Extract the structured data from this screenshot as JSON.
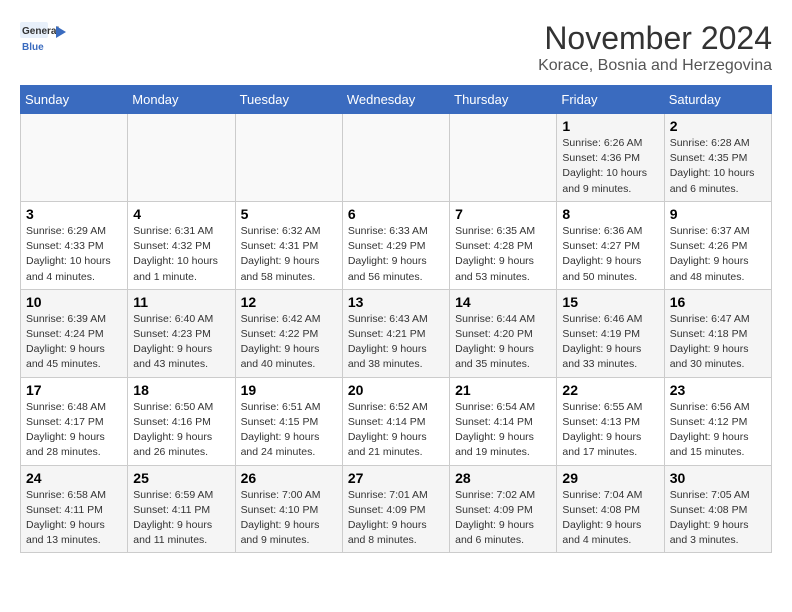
{
  "logo": {
    "text_general": "General",
    "text_blue": "Blue"
  },
  "title": "November 2024",
  "subtitle": "Korace, Bosnia and Herzegovina",
  "days_of_week": [
    "Sunday",
    "Monday",
    "Tuesday",
    "Wednesday",
    "Thursday",
    "Friday",
    "Saturday"
  ],
  "weeks": [
    [
      {
        "day": "",
        "info": ""
      },
      {
        "day": "",
        "info": ""
      },
      {
        "day": "",
        "info": ""
      },
      {
        "day": "",
        "info": ""
      },
      {
        "day": "",
        "info": ""
      },
      {
        "day": "1",
        "info": "Sunrise: 6:26 AM\nSunset: 4:36 PM\nDaylight: 10 hours and 9 minutes."
      },
      {
        "day": "2",
        "info": "Sunrise: 6:28 AM\nSunset: 4:35 PM\nDaylight: 10 hours and 6 minutes."
      }
    ],
    [
      {
        "day": "3",
        "info": "Sunrise: 6:29 AM\nSunset: 4:33 PM\nDaylight: 10 hours and 4 minutes."
      },
      {
        "day": "4",
        "info": "Sunrise: 6:31 AM\nSunset: 4:32 PM\nDaylight: 10 hours and 1 minute."
      },
      {
        "day": "5",
        "info": "Sunrise: 6:32 AM\nSunset: 4:31 PM\nDaylight: 9 hours and 58 minutes."
      },
      {
        "day": "6",
        "info": "Sunrise: 6:33 AM\nSunset: 4:29 PM\nDaylight: 9 hours and 56 minutes."
      },
      {
        "day": "7",
        "info": "Sunrise: 6:35 AM\nSunset: 4:28 PM\nDaylight: 9 hours and 53 minutes."
      },
      {
        "day": "8",
        "info": "Sunrise: 6:36 AM\nSunset: 4:27 PM\nDaylight: 9 hours and 50 minutes."
      },
      {
        "day": "9",
        "info": "Sunrise: 6:37 AM\nSunset: 4:26 PM\nDaylight: 9 hours and 48 minutes."
      }
    ],
    [
      {
        "day": "10",
        "info": "Sunrise: 6:39 AM\nSunset: 4:24 PM\nDaylight: 9 hours and 45 minutes."
      },
      {
        "day": "11",
        "info": "Sunrise: 6:40 AM\nSunset: 4:23 PM\nDaylight: 9 hours and 43 minutes."
      },
      {
        "day": "12",
        "info": "Sunrise: 6:42 AM\nSunset: 4:22 PM\nDaylight: 9 hours and 40 minutes."
      },
      {
        "day": "13",
        "info": "Sunrise: 6:43 AM\nSunset: 4:21 PM\nDaylight: 9 hours and 38 minutes."
      },
      {
        "day": "14",
        "info": "Sunrise: 6:44 AM\nSunset: 4:20 PM\nDaylight: 9 hours and 35 minutes."
      },
      {
        "day": "15",
        "info": "Sunrise: 6:46 AM\nSunset: 4:19 PM\nDaylight: 9 hours and 33 minutes."
      },
      {
        "day": "16",
        "info": "Sunrise: 6:47 AM\nSunset: 4:18 PM\nDaylight: 9 hours and 30 minutes."
      }
    ],
    [
      {
        "day": "17",
        "info": "Sunrise: 6:48 AM\nSunset: 4:17 PM\nDaylight: 9 hours and 28 minutes."
      },
      {
        "day": "18",
        "info": "Sunrise: 6:50 AM\nSunset: 4:16 PM\nDaylight: 9 hours and 26 minutes."
      },
      {
        "day": "19",
        "info": "Sunrise: 6:51 AM\nSunset: 4:15 PM\nDaylight: 9 hours and 24 minutes."
      },
      {
        "day": "20",
        "info": "Sunrise: 6:52 AM\nSunset: 4:14 PM\nDaylight: 9 hours and 21 minutes."
      },
      {
        "day": "21",
        "info": "Sunrise: 6:54 AM\nSunset: 4:14 PM\nDaylight: 9 hours and 19 minutes."
      },
      {
        "day": "22",
        "info": "Sunrise: 6:55 AM\nSunset: 4:13 PM\nDaylight: 9 hours and 17 minutes."
      },
      {
        "day": "23",
        "info": "Sunrise: 6:56 AM\nSunset: 4:12 PM\nDaylight: 9 hours and 15 minutes."
      }
    ],
    [
      {
        "day": "24",
        "info": "Sunrise: 6:58 AM\nSunset: 4:11 PM\nDaylight: 9 hours and 13 minutes."
      },
      {
        "day": "25",
        "info": "Sunrise: 6:59 AM\nSunset: 4:11 PM\nDaylight: 9 hours and 11 minutes."
      },
      {
        "day": "26",
        "info": "Sunrise: 7:00 AM\nSunset: 4:10 PM\nDaylight: 9 hours and 9 minutes."
      },
      {
        "day": "27",
        "info": "Sunrise: 7:01 AM\nSunset: 4:09 PM\nDaylight: 9 hours and 8 minutes."
      },
      {
        "day": "28",
        "info": "Sunrise: 7:02 AM\nSunset: 4:09 PM\nDaylight: 9 hours and 6 minutes."
      },
      {
        "day": "29",
        "info": "Sunrise: 7:04 AM\nSunset: 4:08 PM\nDaylight: 9 hours and 4 minutes."
      },
      {
        "day": "30",
        "info": "Sunrise: 7:05 AM\nSunset: 4:08 PM\nDaylight: 9 hours and 3 minutes."
      }
    ]
  ]
}
